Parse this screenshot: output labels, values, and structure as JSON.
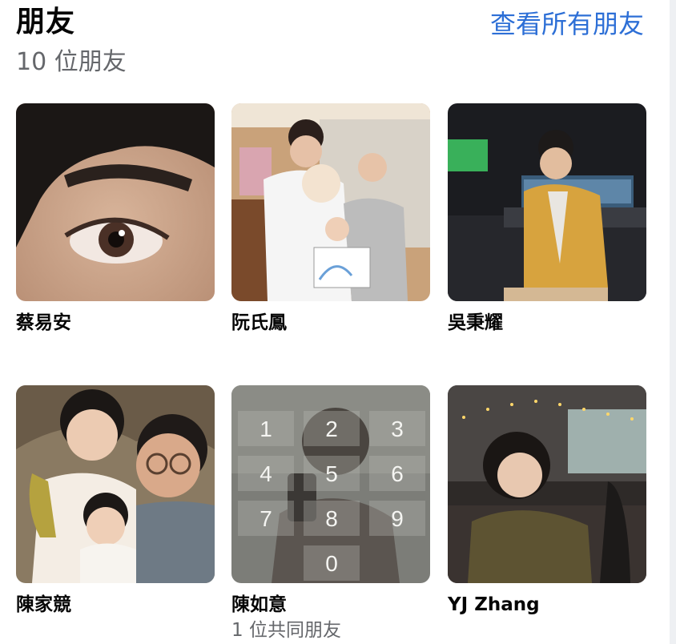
{
  "section": {
    "title": "朋友",
    "count": "10 位朋友",
    "see_all": "查看所有朋友"
  },
  "friends": [
    {
      "name": "蔡易安",
      "mutual": ""
    },
    {
      "name": "阮氏鳳",
      "mutual": ""
    },
    {
      "name": "吳秉耀",
      "mutual": ""
    },
    {
      "name": "陳家競",
      "mutual": ""
    },
    {
      "name": "陳如意",
      "mutual": "1 位共同朋友",
      "keypad_digits": [
        "1",
        "2",
        "3",
        "4",
        "5",
        "6",
        "7",
        "8",
        "9",
        "0"
      ]
    },
    {
      "name": "YJ Zhang",
      "mutual": ""
    }
  ]
}
